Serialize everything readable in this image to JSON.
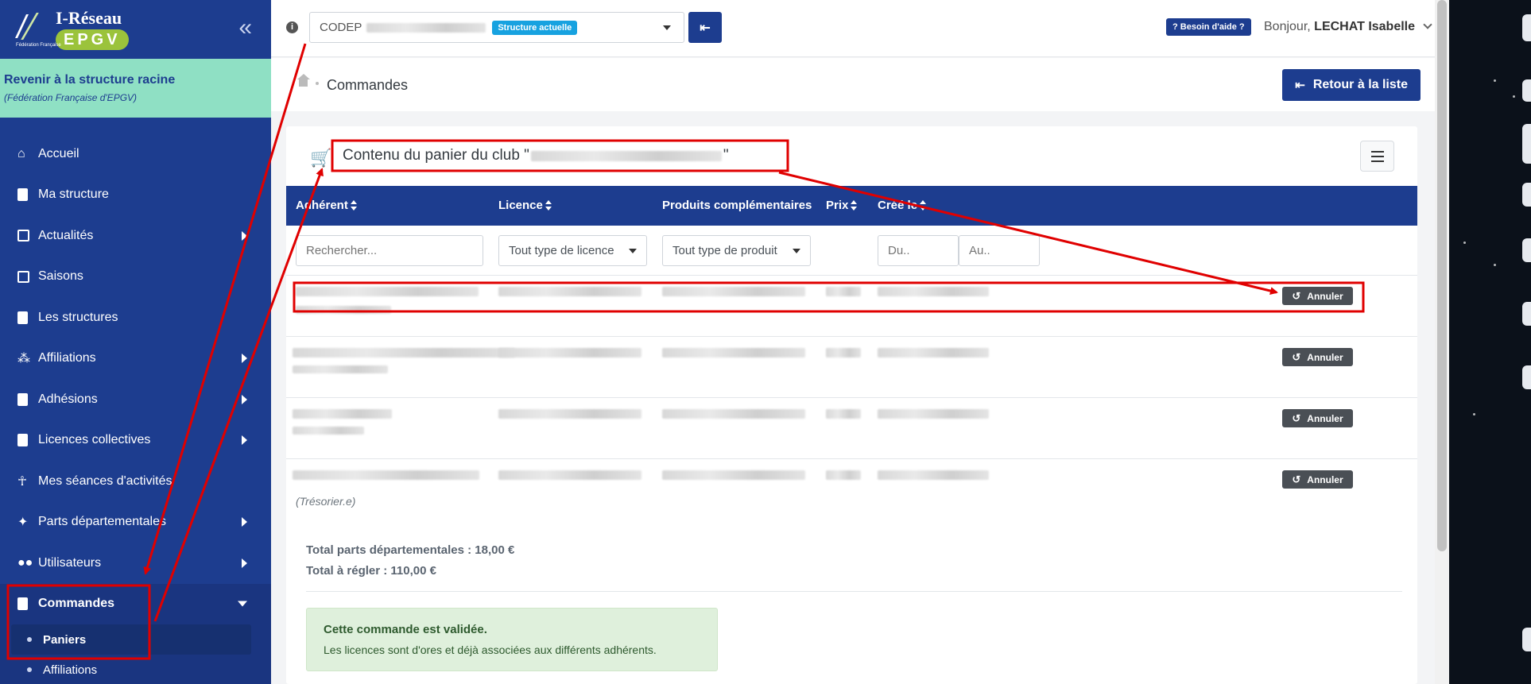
{
  "brand": {
    "name": "I-Réseau",
    "sub": "EPGV",
    "federation": "Fédération Française"
  },
  "sidebar": {
    "collapse_icon": "double-chevron-left-icon",
    "root_link": "Revenir à la structure racine",
    "root_sub": "(Fédération Française d'EPGV)",
    "items": [
      {
        "label": "Accueil",
        "icon": "home-icon",
        "arrow": false
      },
      {
        "label": "Ma structure",
        "icon": "id-card-icon",
        "arrow": false
      },
      {
        "label": "Actualités",
        "icon": "newspaper-icon",
        "arrow": true
      },
      {
        "label": "Saisons",
        "icon": "calendar-icon",
        "arrow": false
      },
      {
        "label": "Les structures",
        "icon": "building-icon",
        "arrow": false
      },
      {
        "label": "Affiliations",
        "icon": "sitemap-icon",
        "arrow": true
      },
      {
        "label": "Adhésions",
        "icon": "id-badge-icon",
        "arrow": true
      },
      {
        "label": "Licences collectives",
        "icon": "id-badge-icon",
        "arrow": true
      },
      {
        "label": "Mes séances d'activités",
        "icon": "running-icon",
        "arrow": false
      },
      {
        "label": "Parts départementales",
        "icon": "map-icon",
        "arrow": true
      },
      {
        "label": "Utilisateurs",
        "icon": "users-icon",
        "arrow": true
      },
      {
        "label": "Commandes",
        "icon": "receipt-icon",
        "arrow": true
      }
    ],
    "sub_items": [
      {
        "label": "Paniers"
      },
      {
        "label": "Affiliations"
      }
    ]
  },
  "topbar": {
    "structure_prefix": "CODEP",
    "structure_badge": "Structure actuelle",
    "help_label": "Besoin d'aide ?",
    "greeting": "Bonjour,",
    "user_name": "LECHAT Isabelle"
  },
  "breadcrumb": {
    "title": "Commandes",
    "back_button": "Retour à la liste"
  },
  "card": {
    "title_prefix": "Contenu du panier du club \"",
    "title_suffix": "\"",
    "columns": [
      "Adhérent",
      "Licence",
      "Produits complémentaires",
      "Prix",
      "Créé le"
    ],
    "filters": {
      "search_placeholder": "Rechercher...",
      "licence_select": "Tout type de licence",
      "product_select": "Tout type de produit",
      "date_from": "Du..",
      "date_to": "Au.."
    },
    "row_action": "Annuler",
    "role_note": "(Trésorier.e)",
    "total_parts": "Total parts départementales : 18,00 €",
    "total_due": "Total à régler : 110,00 €",
    "alert_title": "Cette commande est validée.",
    "alert_text": "Les licences sont d'ores et déjà associées aux différents adhérents."
  },
  "colors": {
    "primary": "#1d3d8f",
    "accent_green": "#8fe0c4",
    "badge_blue": "#17a2e0",
    "annotation_red": "#e00000"
  }
}
